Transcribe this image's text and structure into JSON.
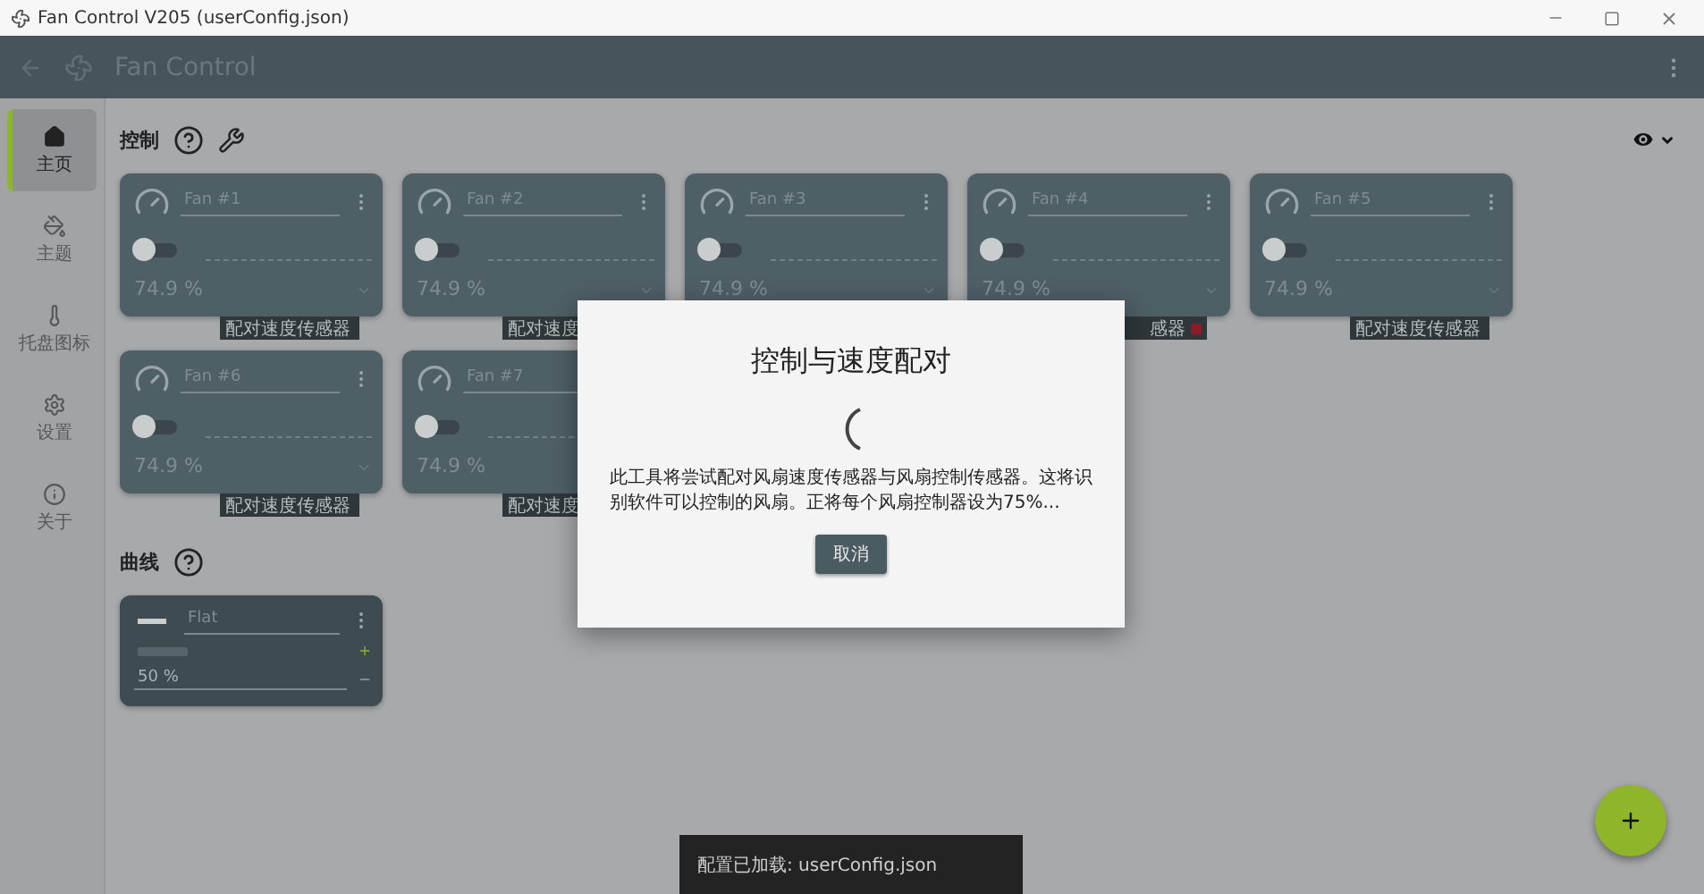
{
  "window": {
    "title": "Fan Control V205 (userConfig.json)"
  },
  "app_bar": {
    "title": "Fan Control"
  },
  "sidebar": {
    "items": [
      {
        "label": "主页",
        "selected": true
      },
      {
        "label": "主题",
        "selected": false
      },
      {
        "label": "托盘图标",
        "selected": false
      },
      {
        "label": "设置",
        "selected": false
      },
      {
        "label": "关于",
        "selected": false
      }
    ]
  },
  "controls": {
    "title": "控制",
    "cards": [
      {
        "name": "Fan #1",
        "on": false,
        "value": "74.9 %",
        "tag": "配对速度传感器",
        "tag_cut_left": false
      },
      {
        "name": "Fan #2",
        "on": false,
        "value": "74.9 %",
        "tag": "配对速度",
        "tag_cut_left": false
      },
      {
        "name": "Fan #3",
        "on": false,
        "value": "74.9 %"
      },
      {
        "name": "Fan #4",
        "on": false,
        "value": "74.9 %",
        "tag": "感器",
        "tag_cut_left": true
      },
      {
        "name": "Fan #5",
        "on": false,
        "value": "74.9 %",
        "tag": "配对速度传感器",
        "tag_cut_left": false
      },
      {
        "name": "Fan #6",
        "on": false,
        "value": "74.9 %",
        "tag": "配对速度传感器",
        "tag_cut_left": false
      },
      {
        "name": "Fan #7",
        "on": false,
        "value": "74.9 %",
        "tag": "配对速度",
        "tag_cut_left": false
      }
    ]
  },
  "curves": {
    "title": "曲线",
    "cards": [
      {
        "name": "Flat",
        "value": "50 %"
      }
    ]
  },
  "dialog": {
    "title": "控制与速度配对",
    "message": "此工具将尝试配对风扇速度传感器与风扇控制传感器。这将识别软件可以控制的风扇。正将每个风扇控制器设为75%...",
    "button": "取消"
  },
  "snackbar": {
    "text": "配置已加载: userConfig.json"
  }
}
